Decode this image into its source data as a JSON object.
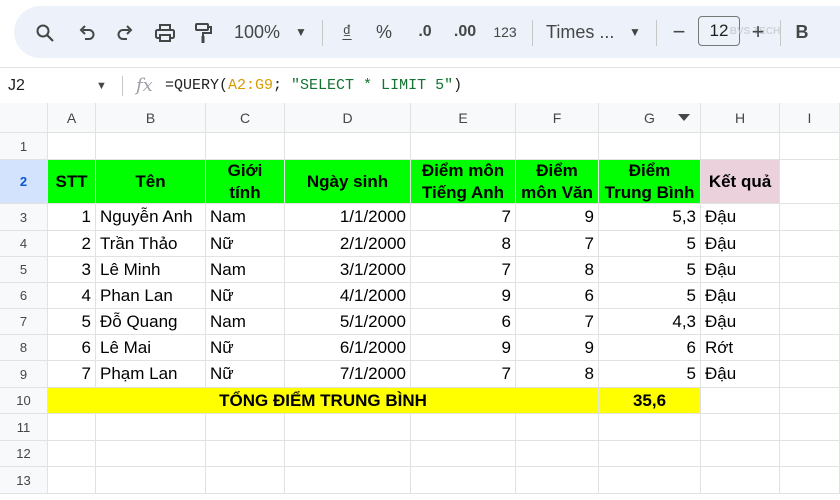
{
  "toolbar": {
    "zoom": "100%",
    "currency": "₫",
    "percent": "%",
    "decrease_decimal": ".0",
    "increase_decimal": ".00",
    "number_format": "123",
    "font_name": "Times ...",
    "font_size": "12",
    "bold": "B",
    "minus": "−",
    "plus": "+",
    "watermark": "BVS TECH"
  },
  "formula_bar": {
    "cell_ref": "J2",
    "fx": "fx",
    "formula_prefix": "=QUERY(",
    "formula_range": "A2:G9",
    "formula_sep": "; ",
    "formula_string": "\"SELECT * LIMIT 5\"",
    "formula_suffix": ")"
  },
  "columns": [
    "A",
    "B",
    "C",
    "D",
    "E",
    "F",
    "G",
    "H",
    "I"
  ],
  "rows": [
    "1",
    "2",
    "3",
    "4",
    "5",
    "6",
    "7",
    "8",
    "9",
    "10",
    "11",
    "12",
    "13"
  ],
  "table": {
    "headers": [
      "STT",
      "Tên",
      "Giới tính",
      "Ngày sinh",
      "Điểm môn Tiếng Anh",
      "Điểm môn Văn",
      "Điểm Trung Bình",
      "Kết quả"
    ],
    "data_rows": [
      [
        "1",
        "Nguyễn Anh",
        "Nam",
        "1/1/2000",
        "7",
        "9",
        "5,3",
        "Đậu"
      ],
      [
        "2",
        "Trần Thảo",
        "Nữ",
        "2/1/2000",
        "8",
        "7",
        "5",
        "Đậu"
      ],
      [
        "3",
        "Lê Minh",
        "Nam",
        "3/1/2000",
        "7",
        "8",
        "5",
        "Đậu"
      ],
      [
        "4",
        "Phan Lan",
        "Nữ",
        "4/1/2000",
        "9",
        "6",
        "5",
        "Đậu"
      ],
      [
        "5",
        "Đỗ Quang",
        "Nam",
        "5/1/2000",
        "6",
        "7",
        "4,3",
        "Đậu"
      ],
      [
        "6",
        "Lê Mai",
        "Nữ",
        "6/1/2000",
        "9",
        "9",
        "6",
        "Rớt"
      ],
      [
        "7",
        "Phạm Lan",
        "Nữ",
        "7/1/2000",
        "7",
        "8",
        "5",
        "Đậu"
      ]
    ],
    "total_label": "TỔNG ĐIỂM TRUNG BÌNH",
    "total_value": "35,6"
  },
  "colors": {
    "header_green": "#00ff00",
    "result_pink": "#ead1dc",
    "total_yellow": "#ffff00",
    "selected_header": "#d3e3fd"
  }
}
